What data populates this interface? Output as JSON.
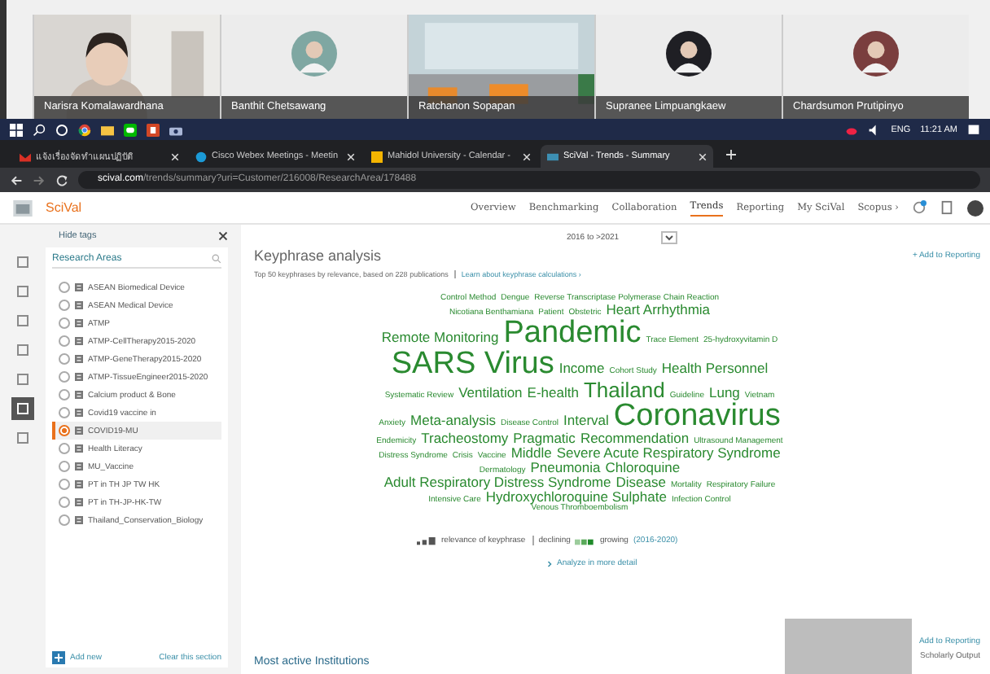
{
  "participants": [
    {
      "name": "Narisra Komalawardhana",
      "kind": "camera"
    },
    {
      "name": "Banthit Chetsawang",
      "kind": "avatar"
    },
    {
      "name": "Ratchanon Sopapan",
      "kind": "room"
    },
    {
      "name": "Supranee Limpuangkaew",
      "kind": "avatar"
    },
    {
      "name": "Chardsumon Prutipinyo",
      "kind": "avatar"
    }
  ],
  "taskbar": {
    "language": "ENG",
    "time": "11:21 AM"
  },
  "browser_tabs": [
    {
      "title": "แจ้งเรื่องจัดทำแผนปฏิบัติ",
      "selected": false,
      "kind": "mail"
    },
    {
      "title": "Cisco Webex Meetings - Meetin",
      "selected": false,
      "kind": "webex"
    },
    {
      "title": "Mahidol University - Calendar - ",
      "selected": false,
      "kind": "calendar"
    },
    {
      "title": "SciVal - Trends - Summary",
      "selected": true,
      "kind": "scival"
    }
  ],
  "address": {
    "host": "scival.com",
    "path": "/trends/summary?uri=Customer/216008/ResearchArea/178488"
  },
  "app": {
    "logo": "SciVal",
    "nav": [
      {
        "label": "Overview",
        "selected": false
      },
      {
        "label": "Benchmarking",
        "selected": false
      },
      {
        "label": "Collaboration",
        "selected": false
      },
      {
        "label": "Trends",
        "selected": true
      },
      {
        "label": "Reporting",
        "selected": false
      },
      {
        "label": "My SciVal",
        "selected": false
      },
      {
        "label": "Scopus ›",
        "selected": false
      }
    ]
  },
  "panel": {
    "hide_tags": "Hide tags",
    "section": "Research Areas",
    "items": [
      {
        "label": "ASEAN Biomedical Device",
        "selected": false
      },
      {
        "label": "ASEAN Medical Device",
        "selected": false
      },
      {
        "label": "ATMP",
        "selected": false
      },
      {
        "label": "ATMP-CellTherapy2015-2020",
        "selected": false
      },
      {
        "label": "ATMP-GeneTherapy2015-2020",
        "selected": false
      },
      {
        "label": "ATMP-TissueEngineer2015-2020",
        "selected": false
      },
      {
        "label": "Calcium product & Bone",
        "selected": false
      },
      {
        "label": "Covid19 vaccine in",
        "selected": false
      },
      {
        "label": "COVID19-MU",
        "selected": true
      },
      {
        "label": "Health Literacy",
        "selected": false
      },
      {
        "label": "MU_Vaccine",
        "selected": false
      },
      {
        "label": "PT in TH JP TW HK",
        "selected": false
      },
      {
        "label": "PT in TH-JP-HK-TW",
        "selected": false
      },
      {
        "label": "Thailand_Conservation_Biology",
        "selected": false
      }
    ],
    "add_new": "Add new",
    "clear": "Clear this section"
  },
  "main": {
    "period": "2016 to >2021",
    "heading": "Keyphrase analysis",
    "summary": "Top 50 keyphrases by relevance, based on 228 publications",
    "learn_link": "Learn about keyphrase calculations ›",
    "add_reporting": "+ Add to Reporting",
    "cloud": [
      [
        {
          "text": "Control Method",
          "kind": "low"
        },
        {
          "text": "Dengue",
          "kind": "low"
        },
        {
          "text": "Reverse Transcriptase Polymerase Chain Reaction",
          "kind": "low"
        }
      ],
      [
        {
          "text": "Nicotiana Benthamiana",
          "kind": "low"
        },
        {
          "text": "Patient",
          "kind": "low"
        },
        {
          "text": "Obstetric",
          "kind": "low"
        },
        {
          "text": "Heart Arrhythmia",
          "kind": "mid"
        }
      ],
      [
        {
          "text": "Remote Monitoring",
          "kind": "mid"
        },
        {
          "text": "Pandemic",
          "kind": "top"
        },
        {
          "text": "Trace Element",
          "kind": "low"
        },
        {
          "text": "25-hydroxyvitamin D",
          "kind": "low"
        }
      ],
      [
        {
          "text": "SARS Virus",
          "kind": "top"
        },
        {
          "text": "Income",
          "kind": "mid"
        },
        {
          "text": "Cohort Study",
          "kind": "low"
        },
        {
          "text": "Health Personnel",
          "kind": "mid"
        }
      ],
      [
        {
          "text": "Systematic Review",
          "kind": "low"
        },
        {
          "text": "Ventilation",
          "kind": "mid"
        },
        {
          "text": "E-health",
          "kind": "mid"
        },
        {
          "text": "Thailand",
          "kind": "high"
        },
        {
          "text": "Guideline",
          "kind": "low"
        },
        {
          "text": "Lung",
          "kind": "mid"
        },
        {
          "text": "Vietnam",
          "kind": "low"
        }
      ],
      [
        {
          "text": "Anxiety",
          "kind": "low"
        },
        {
          "text": "Meta-analysis",
          "kind": "mid"
        },
        {
          "text": "Disease Control",
          "kind": "low"
        },
        {
          "text": "Interval",
          "kind": "mid"
        },
        {
          "text": "Coronavirus",
          "kind": "top"
        }
      ],
      [
        {
          "text": "Endemicity",
          "kind": "low"
        },
        {
          "text": "Tracheostomy",
          "kind": "mid"
        },
        {
          "text": "Pragmatic",
          "kind": "mid"
        },
        {
          "text": "Recommendation",
          "kind": "mid"
        },
        {
          "text": "Ultrasound Management",
          "kind": "low"
        }
      ],
      [
        {
          "text": "Distress Syndrome",
          "kind": "low"
        },
        {
          "text": "Crisis",
          "kind": "low"
        },
        {
          "text": "Vaccine",
          "kind": "low"
        },
        {
          "text": "Middle",
          "kind": "mid"
        },
        {
          "text": "Severe Acute Respiratory Syndrome",
          "kind": "mid"
        }
      ],
      [
        {
          "text": "Dermatology",
          "kind": "low"
        },
        {
          "text": "Pneumonia",
          "kind": "mid"
        },
        {
          "text": "Chloroquine",
          "kind": "mid"
        }
      ],
      [
        {
          "text": "Adult Respiratory Distress Syndrome",
          "kind": "mid"
        },
        {
          "text": "Disease",
          "kind": "mid"
        },
        {
          "text": "Mortality",
          "kind": "low"
        },
        {
          "text": "Respiratory Failure",
          "kind": "low"
        }
      ],
      [
        {
          "text": "Intensive Care",
          "kind": "low"
        },
        {
          "text": "Hydroxychloroquine Sulphate",
          "kind": "mid"
        },
        {
          "text": "Infection Control",
          "kind": "low"
        }
      ],
      [
        {
          "text": "Venous Thromboembolism",
          "kind": "low"
        }
      ]
    ],
    "legend": {
      "relevance": "relevance of keyphrase",
      "declining": "declining",
      "growing": "growing",
      "period": "(2016-2020)"
    },
    "analyze": "Analyze in more detail",
    "institutions": "Most active Institutions",
    "add_reporting_2": "Add to Reporting",
    "metric": "Scholarly Output"
  }
}
